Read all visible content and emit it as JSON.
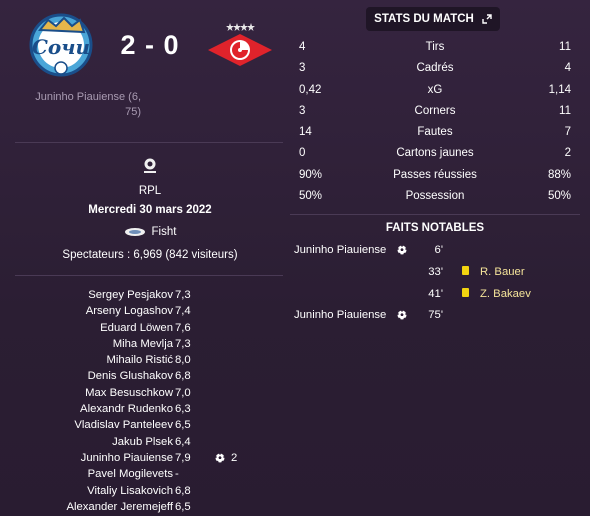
{
  "match": {
    "home_team": "Sochi",
    "away_team": "Spartak",
    "score": "2 - 0",
    "home_scorer_text": "Juninho Piauiense (6, 75)",
    "competition": "RPL",
    "date": "Mercredi 30 mars 2022",
    "stadium": "Fisht",
    "attendance": "Spectateurs : 6,969 (842 visiteurs)"
  },
  "stats_button": {
    "label": "STATS DU MATCH"
  },
  "stats": [
    {
      "home": "4",
      "label": "Tirs",
      "away": "11"
    },
    {
      "home": "3",
      "label": "Cadrés",
      "away": "4"
    },
    {
      "home": "0,42",
      "label": "xG",
      "away": "1,14"
    },
    {
      "home": "3",
      "label": "Corners",
      "away": "11"
    },
    {
      "home": "14",
      "label": "Fautes",
      "away": "7"
    },
    {
      "home": "0",
      "label": "Cartons jaunes",
      "away": "2"
    },
    {
      "home": "90%",
      "label": "Passes réussies",
      "away": "88%"
    },
    {
      "home": "50%",
      "label": "Possession",
      "away": "50%"
    }
  ],
  "faits": {
    "title": "FAITS NOTABLES",
    "events": [
      {
        "home_player": "Juninho Piauiense",
        "minute": "6'",
        "away_player": ""
      },
      {
        "home_player": "",
        "minute": "33'",
        "away_player": "R. Bauer"
      },
      {
        "home_player": "",
        "minute": "41'",
        "away_player": "Z. Bakaev"
      },
      {
        "home_player": "Juninho Piauiense",
        "minute": "75'",
        "away_player": ""
      }
    ]
  },
  "ratings": [
    {
      "name": "Sergey Pesjakov",
      "rating": "7,3",
      "goals": ""
    },
    {
      "name": "Arseny Logashov",
      "rating": "7,4",
      "goals": ""
    },
    {
      "name": "Eduard Löwen",
      "rating": "7,6",
      "goals": ""
    },
    {
      "name": "Miha Mevlja",
      "rating": "7,3",
      "goals": ""
    },
    {
      "name": "Mihailo Ristić",
      "rating": "8,0",
      "goals": ""
    },
    {
      "name": "Denis Glushakov",
      "rating": "6,8",
      "goals": ""
    },
    {
      "name": "Max Besuschkow",
      "rating": "7,0",
      "goals": ""
    },
    {
      "name": "Alexandr Rudenko",
      "rating": "6,3",
      "goals": ""
    },
    {
      "name": "Vladislav Panteleev",
      "rating": "6,5",
      "goals": ""
    },
    {
      "name": "Jakub Plsek",
      "rating": "6,4",
      "goals": ""
    },
    {
      "name": "Juninho Piauiense",
      "rating": "7,9",
      "goals": "2"
    },
    {
      "name": "Pavel Mogilevets",
      "rating": "-",
      "goals": ""
    },
    {
      "name": "Vitaliy Lisakovich",
      "rating": "6,8",
      "goals": ""
    },
    {
      "name": "Alexander Jeremejeff",
      "rating": "6,5",
      "goals": ""
    }
  ],
  "icons": {
    "home_logo": "sochi-crest-icon",
    "away_logo": "spartak-crest-icon",
    "competition": "rpl-logo-icon",
    "stadium": "stadium-icon",
    "expand": "expand-icon",
    "goal": "ball-icon",
    "yellow_card": "yellow-card-icon"
  },
  "colors": {
    "background": "#2d1f36",
    "button_bg": "#1f1526",
    "away_event_text": "#f4e39a",
    "yellow_card": "#f2d410",
    "spartak_red": "#e0232b"
  }
}
